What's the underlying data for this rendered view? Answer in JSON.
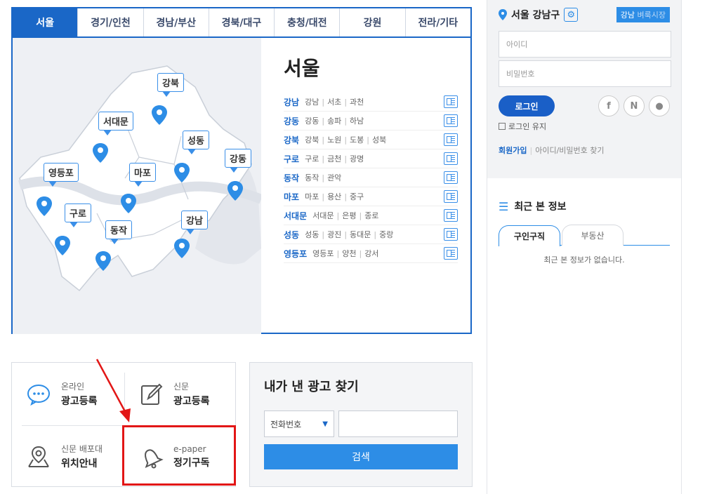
{
  "tabs": [
    "서울",
    "경기/인천",
    "경남/부산",
    "경북/대구",
    "충청/대전",
    "강원",
    "전라/기타"
  ],
  "map_labels": [
    "강북",
    "서대문",
    "성동",
    "마포",
    "강동",
    "영등포",
    "구로",
    "동작",
    "강남"
  ],
  "area_title": "서울",
  "areas": [
    {
      "name": "강남",
      "subs": [
        "강남",
        "서초",
        "과천"
      ]
    },
    {
      "name": "강동",
      "subs": [
        "강동",
        "송파",
        "하남"
      ]
    },
    {
      "name": "강북",
      "subs": [
        "강북",
        "노원",
        "도봉",
        "성북"
      ]
    },
    {
      "name": "구로",
      "subs": [
        "구로",
        "금천",
        "광명"
      ]
    },
    {
      "name": "동작",
      "subs": [
        "동작",
        "관악"
      ]
    },
    {
      "name": "마포",
      "subs": [
        "마포",
        "용산",
        "중구"
      ]
    },
    {
      "name": "서대문",
      "subs": [
        "서대문",
        "은평",
        "종로"
      ]
    },
    {
      "name": "성동",
      "subs": [
        "성동",
        "광진",
        "동대문",
        "중랑"
      ]
    },
    {
      "name": "영등포",
      "subs": [
        "영등포",
        "양천",
        "강서"
      ]
    }
  ],
  "services": {
    "online": {
      "l1": "온라인",
      "l2": "광고등록"
    },
    "newspaper": {
      "l1": "신문",
      "l2": "광고등록"
    },
    "stand": {
      "l1": "신문 배포대",
      "l2": "위치안내"
    },
    "epaper": {
      "l1": "e-paper",
      "l2": "정기구독"
    }
  },
  "find": {
    "title": "내가 낸 광고 찾기",
    "select_value": "전화번호",
    "button": "검색"
  },
  "login": {
    "location": "서울 강남구",
    "badge_main": "강남",
    "badge_sub": "벼룩시장",
    "id_placeholder": "아이디",
    "pw_placeholder": "비밀번호",
    "login_button": "로그인",
    "keep": "로그인 유지",
    "join": "회원가입",
    "find_account": "아이디/비밀번호 찾기",
    "social": [
      "f",
      "N",
      "●"
    ]
  },
  "recent": {
    "title": "최근 본 정보",
    "tabs": [
      "구인구직",
      "부동산"
    ],
    "empty": "최근 본 정보가 없습니다."
  },
  "colors": {
    "accent": "#1a67c7",
    "highlight": "#e21616"
  }
}
